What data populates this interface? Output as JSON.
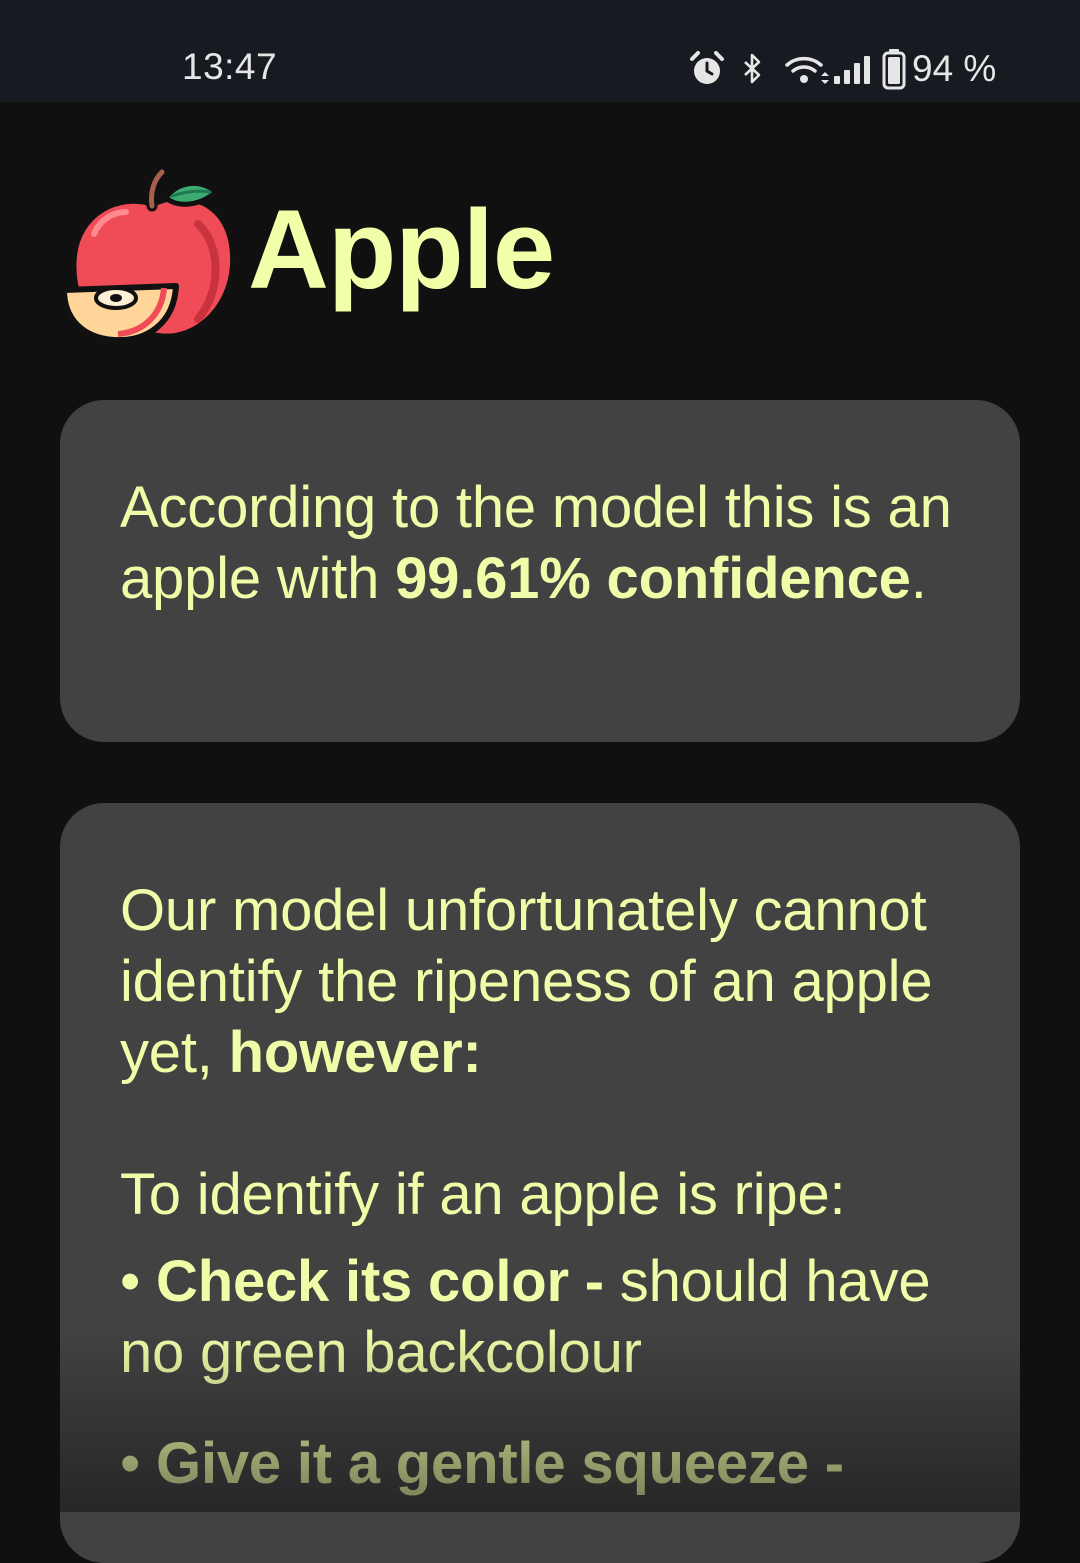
{
  "status_bar": {
    "time": "13:47",
    "battery": "94 %",
    "icons": [
      "alarm-icon",
      "bluetooth-icon",
      "wifi-icon",
      "signal-icon",
      "battery-icon"
    ]
  },
  "header": {
    "title": "Apple",
    "logo_icon": "apple-icon"
  },
  "confidence_card": {
    "text_1": "According to the model this is an apple with ",
    "confidence": "99.61%",
    "confidence_word": "confidence",
    "end": "."
  },
  "ripeness_card": {
    "intro": "Our model unfortunately cannot identify the ripeness of an apple yet, ",
    "however": "however:",
    "heading": "To identify if an apple is ripe:",
    "tips": [
      {
        "bullet": "• ",
        "title": "Check its color - ",
        "desc": "should have no green backcolour"
      },
      {
        "bullet": "• ",
        "title": "Give it a gentle squeeze -",
        "desc": ""
      }
    ]
  },
  "colors": {
    "background": "#101011",
    "status_bar": "#171A20",
    "card": "#424242",
    "text_accent": "#EEFEA8"
  }
}
